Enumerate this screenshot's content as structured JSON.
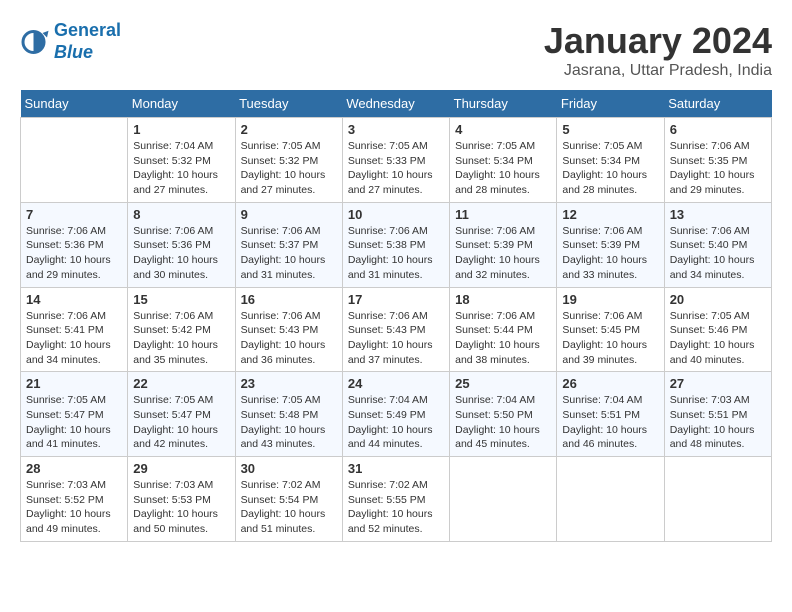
{
  "header": {
    "logo_line1": "General",
    "logo_line2": "Blue",
    "month_year": "January 2024",
    "location": "Jasrana, Uttar Pradesh, India"
  },
  "weekdays": [
    "Sunday",
    "Monday",
    "Tuesday",
    "Wednesday",
    "Thursday",
    "Friday",
    "Saturday"
  ],
  "weeks": [
    [
      {
        "day": "",
        "sunrise": "",
        "sunset": "",
        "daylight": ""
      },
      {
        "day": "1",
        "sunrise": "Sunrise: 7:04 AM",
        "sunset": "Sunset: 5:32 PM",
        "daylight": "Daylight: 10 hours and 27 minutes."
      },
      {
        "day": "2",
        "sunrise": "Sunrise: 7:05 AM",
        "sunset": "Sunset: 5:32 PM",
        "daylight": "Daylight: 10 hours and 27 minutes."
      },
      {
        "day": "3",
        "sunrise": "Sunrise: 7:05 AM",
        "sunset": "Sunset: 5:33 PM",
        "daylight": "Daylight: 10 hours and 27 minutes."
      },
      {
        "day": "4",
        "sunrise": "Sunrise: 7:05 AM",
        "sunset": "Sunset: 5:34 PM",
        "daylight": "Daylight: 10 hours and 28 minutes."
      },
      {
        "day": "5",
        "sunrise": "Sunrise: 7:05 AM",
        "sunset": "Sunset: 5:34 PM",
        "daylight": "Daylight: 10 hours and 28 minutes."
      },
      {
        "day": "6",
        "sunrise": "Sunrise: 7:06 AM",
        "sunset": "Sunset: 5:35 PM",
        "daylight": "Daylight: 10 hours and 29 minutes."
      }
    ],
    [
      {
        "day": "7",
        "sunrise": "Sunrise: 7:06 AM",
        "sunset": "Sunset: 5:36 PM",
        "daylight": "Daylight: 10 hours and 29 minutes."
      },
      {
        "day": "8",
        "sunrise": "Sunrise: 7:06 AM",
        "sunset": "Sunset: 5:36 PM",
        "daylight": "Daylight: 10 hours and 30 minutes."
      },
      {
        "day": "9",
        "sunrise": "Sunrise: 7:06 AM",
        "sunset": "Sunset: 5:37 PM",
        "daylight": "Daylight: 10 hours and 31 minutes."
      },
      {
        "day": "10",
        "sunrise": "Sunrise: 7:06 AM",
        "sunset": "Sunset: 5:38 PM",
        "daylight": "Daylight: 10 hours and 31 minutes."
      },
      {
        "day": "11",
        "sunrise": "Sunrise: 7:06 AM",
        "sunset": "Sunset: 5:39 PM",
        "daylight": "Daylight: 10 hours and 32 minutes."
      },
      {
        "day": "12",
        "sunrise": "Sunrise: 7:06 AM",
        "sunset": "Sunset: 5:39 PM",
        "daylight": "Daylight: 10 hours and 33 minutes."
      },
      {
        "day": "13",
        "sunrise": "Sunrise: 7:06 AM",
        "sunset": "Sunset: 5:40 PM",
        "daylight": "Daylight: 10 hours and 34 minutes."
      }
    ],
    [
      {
        "day": "14",
        "sunrise": "Sunrise: 7:06 AM",
        "sunset": "Sunset: 5:41 PM",
        "daylight": "Daylight: 10 hours and 34 minutes."
      },
      {
        "day": "15",
        "sunrise": "Sunrise: 7:06 AM",
        "sunset": "Sunset: 5:42 PM",
        "daylight": "Daylight: 10 hours and 35 minutes."
      },
      {
        "day": "16",
        "sunrise": "Sunrise: 7:06 AM",
        "sunset": "Sunset: 5:43 PM",
        "daylight": "Daylight: 10 hours and 36 minutes."
      },
      {
        "day": "17",
        "sunrise": "Sunrise: 7:06 AM",
        "sunset": "Sunset: 5:43 PM",
        "daylight": "Daylight: 10 hours and 37 minutes."
      },
      {
        "day": "18",
        "sunrise": "Sunrise: 7:06 AM",
        "sunset": "Sunset: 5:44 PM",
        "daylight": "Daylight: 10 hours and 38 minutes."
      },
      {
        "day": "19",
        "sunrise": "Sunrise: 7:06 AM",
        "sunset": "Sunset: 5:45 PM",
        "daylight": "Daylight: 10 hours and 39 minutes."
      },
      {
        "day": "20",
        "sunrise": "Sunrise: 7:05 AM",
        "sunset": "Sunset: 5:46 PM",
        "daylight": "Daylight: 10 hours and 40 minutes."
      }
    ],
    [
      {
        "day": "21",
        "sunrise": "Sunrise: 7:05 AM",
        "sunset": "Sunset: 5:47 PM",
        "daylight": "Daylight: 10 hours and 41 minutes."
      },
      {
        "day": "22",
        "sunrise": "Sunrise: 7:05 AM",
        "sunset": "Sunset: 5:47 PM",
        "daylight": "Daylight: 10 hours and 42 minutes."
      },
      {
        "day": "23",
        "sunrise": "Sunrise: 7:05 AM",
        "sunset": "Sunset: 5:48 PM",
        "daylight": "Daylight: 10 hours and 43 minutes."
      },
      {
        "day": "24",
        "sunrise": "Sunrise: 7:04 AM",
        "sunset": "Sunset: 5:49 PM",
        "daylight": "Daylight: 10 hours and 44 minutes."
      },
      {
        "day": "25",
        "sunrise": "Sunrise: 7:04 AM",
        "sunset": "Sunset: 5:50 PM",
        "daylight": "Daylight: 10 hours and 45 minutes."
      },
      {
        "day": "26",
        "sunrise": "Sunrise: 7:04 AM",
        "sunset": "Sunset: 5:51 PM",
        "daylight": "Daylight: 10 hours and 46 minutes."
      },
      {
        "day": "27",
        "sunrise": "Sunrise: 7:03 AM",
        "sunset": "Sunset: 5:51 PM",
        "daylight": "Daylight: 10 hours and 48 minutes."
      }
    ],
    [
      {
        "day": "28",
        "sunrise": "Sunrise: 7:03 AM",
        "sunset": "Sunset: 5:52 PM",
        "daylight": "Daylight: 10 hours and 49 minutes."
      },
      {
        "day": "29",
        "sunrise": "Sunrise: 7:03 AM",
        "sunset": "Sunset: 5:53 PM",
        "daylight": "Daylight: 10 hours and 50 minutes."
      },
      {
        "day": "30",
        "sunrise": "Sunrise: 7:02 AM",
        "sunset": "Sunset: 5:54 PM",
        "daylight": "Daylight: 10 hours and 51 minutes."
      },
      {
        "day": "31",
        "sunrise": "Sunrise: 7:02 AM",
        "sunset": "Sunset: 5:55 PM",
        "daylight": "Daylight: 10 hours and 52 minutes."
      },
      {
        "day": "",
        "sunrise": "",
        "sunset": "",
        "daylight": ""
      },
      {
        "day": "",
        "sunrise": "",
        "sunset": "",
        "daylight": ""
      },
      {
        "day": "",
        "sunrise": "",
        "sunset": "",
        "daylight": ""
      }
    ]
  ]
}
